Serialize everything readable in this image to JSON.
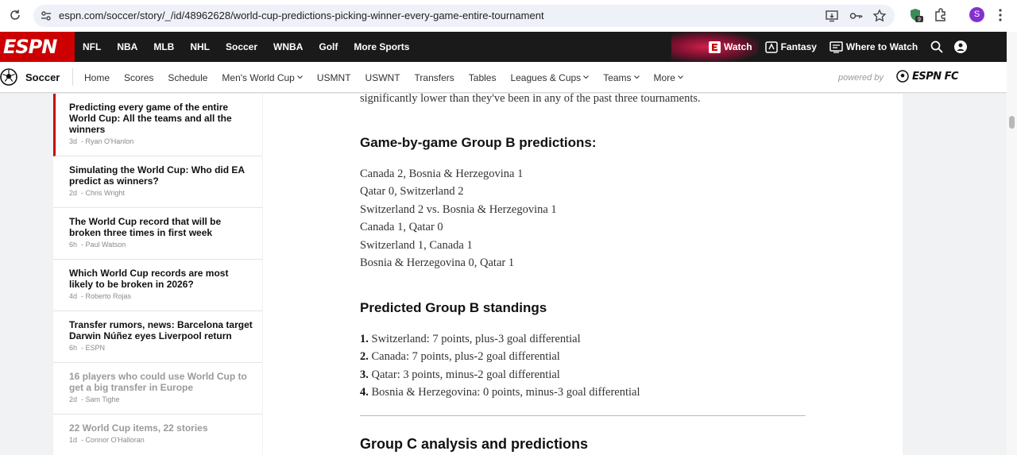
{
  "browser": {
    "url": "espn.com/soccer/story/_/id/48962628/world-cup-predictions-picking-winner-every-game-entire-tournament",
    "profile_initial": "S",
    "extension_badge": "9"
  },
  "espn": {
    "logo_text": "ESPN",
    "top_nav": [
      "NFL",
      "NBA",
      "MLB",
      "NHL",
      "Soccer",
      "WNBA",
      "Golf",
      "More Sports"
    ],
    "right_nav": {
      "watch": "Watch",
      "fantasy": "Fantasy",
      "where_to_watch": "Where to Watch"
    },
    "brand_color": "#cc0000"
  },
  "subnav": {
    "section": "Soccer",
    "items": [
      {
        "label": "Home",
        "dropdown": false
      },
      {
        "label": "Scores",
        "dropdown": false
      },
      {
        "label": "Schedule",
        "dropdown": false
      },
      {
        "label": "Men's World Cup",
        "dropdown": true
      },
      {
        "label": "USMNT",
        "dropdown": false
      },
      {
        "label": "USWNT",
        "dropdown": false
      },
      {
        "label": "Transfers",
        "dropdown": false
      },
      {
        "label": "Tables",
        "dropdown": false
      },
      {
        "label": "Leagues & Cups",
        "dropdown": true
      },
      {
        "label": "Teams",
        "dropdown": true
      },
      {
        "label": "More",
        "dropdown": true
      }
    ],
    "powered_by": "powered by",
    "espnfc": "ESPN FC"
  },
  "related": [
    {
      "title": "Predicting every game of the entire World Cup: All the teams and all the winners",
      "age": "3d",
      "author": "Ryan O'Hanlon"
    },
    {
      "title": "Simulating the World Cup: Who did EA predict as winners?",
      "age": "2d",
      "author": "Chris Wright"
    },
    {
      "title": "The World Cup record that will be broken three times in first week",
      "age": "6h",
      "author": "Paul Watson"
    },
    {
      "title": "Which World Cup records are most likely to be broken in 2026?",
      "age": "4d",
      "author": "Roberto Rojas"
    },
    {
      "title": "Transfer rumors, news: Barcelona target Darwin Núñez eyes Liverpool return",
      "age": "6h",
      "author": "ESPN"
    },
    {
      "title": "16 players who could use World Cup to get a big transfer in Europe",
      "age": "2d",
      "author": "Sam Tighe"
    },
    {
      "title": "22 World Cup items, 22 stories",
      "age": "1d",
      "author": "Connor O'Halloran"
    }
  ],
  "article": {
    "lead_fragment": "significantly lower than they've been in any of the past three tournaments.",
    "games_heading": "Game-by-game Group B predictions:",
    "games": [
      "Canada 2, Bosnia & Herzegovina 1",
      "Qatar 0, Switzerland 2",
      "Switzerland 2 vs. Bosnia & Herzegovina 1",
      "Canada 1, Qatar 0",
      "Switzerland 1, Canada 1",
      "Bosnia & Herzegovina 0, Qatar 1"
    ],
    "standings_heading": "Predicted Group B standings",
    "standings": [
      {
        "rank": "1.",
        "text": "Switzerland: 7 points, plus-3 goal differential"
      },
      {
        "rank": "2.",
        "text": "Canada: 7 points, plus-2 goal differential"
      },
      {
        "rank": "3.",
        "text": "Qatar: 3 points, minus-2 goal differential"
      },
      {
        "rank": "4.",
        "text": "Bosnia & Herzegovina: 0 points, minus-3 goal differential"
      }
    ],
    "next_heading": "Group C analysis and predictions"
  }
}
